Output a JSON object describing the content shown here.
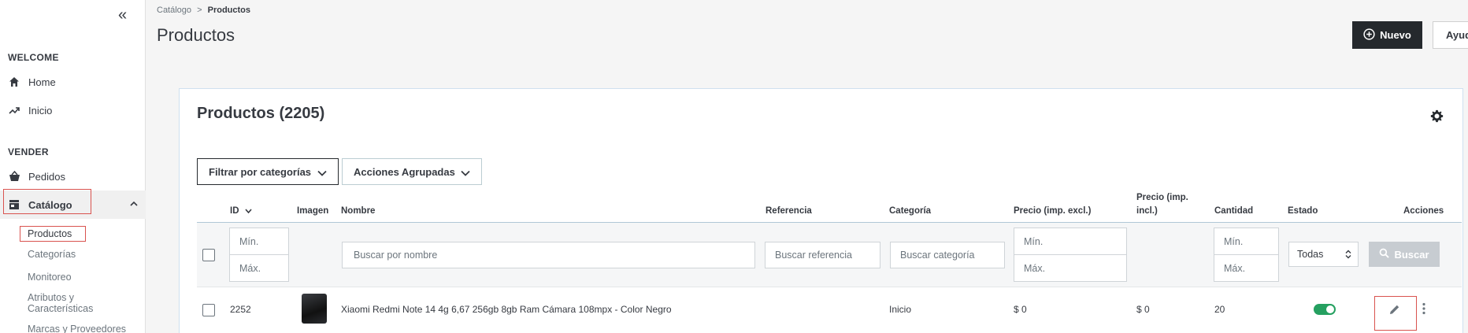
{
  "sidebar": {
    "collapse_icon": "double-chevron-left-icon",
    "sections": [
      {
        "title": "WELCOME"
      },
      {
        "title": "VENDER"
      }
    ],
    "items": [
      {
        "label": "Home",
        "icon": "home-icon"
      },
      {
        "label": "Inicio",
        "icon": "trending-up-icon"
      },
      {
        "label": "Pedidos",
        "icon": "basket-icon"
      },
      {
        "label": "Catálogo",
        "icon": "store-icon"
      }
    ],
    "catalog_sub": [
      {
        "label": "Productos"
      },
      {
        "label": "Categorías"
      },
      {
        "label": "Monitoreo"
      },
      {
        "label": "Atributos y"
      },
      {
        "label": "Características"
      },
      {
        "label": "Marcas y Proveedores"
      }
    ]
  },
  "header": {
    "breadcrumb_parent": "Catálogo",
    "breadcrumb_sep": ">",
    "breadcrumb_current": "Productos",
    "title": "Productos",
    "new_label": "Nuevo",
    "help_label": "Ayud"
  },
  "card": {
    "title": "Productos (2205)",
    "filter_categories": "Filtrar por categorías",
    "bulk_actions": "Acciones Agrupadas"
  },
  "table": {
    "columns": [
      "ID",
      "Imagen",
      "Nombre",
      "Referencia",
      "Categoría",
      "Precio (imp. excl.)",
      "Precio (imp.",
      "incl.)",
      "Cantidad",
      "Estado",
      "Acciones"
    ],
    "filters": {
      "id_min": "Mín.",
      "id_max": "Máx.",
      "name_placeholder": "Buscar por nombre",
      "reference_placeholder": "Buscar referencia",
      "category_placeholder": "Buscar categoría",
      "price_min": "Mín.",
      "price_max": "Máx.",
      "qty_min": "Mín.",
      "qty_max": "Máx.",
      "status_selected": "Todas",
      "search_label": "Buscar"
    },
    "rows": [
      {
        "id": "2252",
        "name": "Xiaomi Redmi Note 14 4g 6,67 256gb 8gb Ram Cámara 108mpx - Color Negro",
        "reference": "",
        "category": "Inicio",
        "price_excl": "$ 0",
        "price_incl": "$ 0",
        "quantity": "20",
        "status": "enabled"
      }
    ]
  },
  "colors": {
    "dark": "#25292d",
    "accent_border": "#d9534f",
    "toggle_on": "#25a060",
    "search_disabled": "#c7ccd1"
  }
}
